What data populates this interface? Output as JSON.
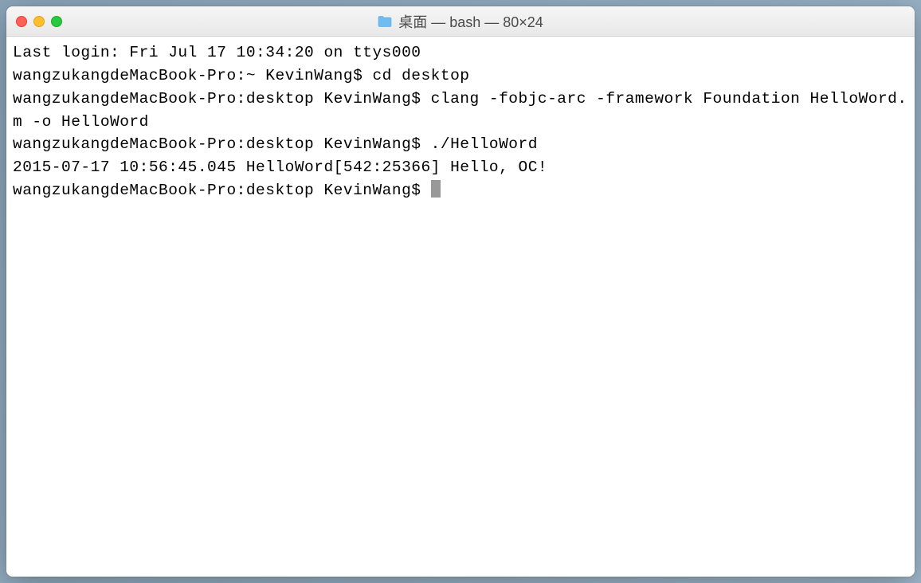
{
  "window": {
    "title": "桌面 — bash — 80×24"
  },
  "terminal": {
    "lines": [
      "Last login: Fri Jul 17 10:34:20 on ttys000",
      "wangzukangdeMacBook-Pro:~ KevinWang$ cd desktop",
      "wangzukangdeMacBook-Pro:desktop KevinWang$ clang -fobjc-arc -framework Foundation HelloWord.m -o HelloWord",
      "wangzukangdeMacBook-Pro:desktop KevinWang$ ./HelloWord",
      "2015-07-17 10:56:45.045 HelloWord[542:25366] Hello, OC!"
    ],
    "prompt": "wangzukangdeMacBook-Pro:desktop KevinWang$ "
  }
}
